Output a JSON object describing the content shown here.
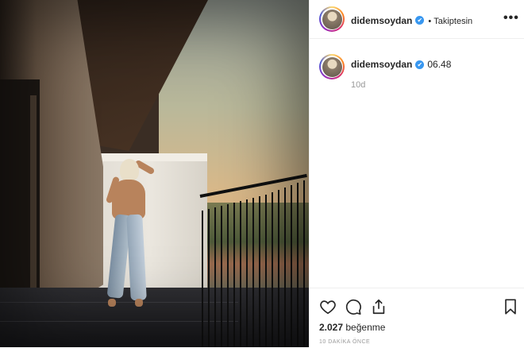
{
  "post": {
    "username": "didemsoydan",
    "verified_glyph": "✔",
    "separator": "•",
    "follow_status": "Takiptesin",
    "more_label": "•••",
    "comment": {
      "username": "didemsoydan",
      "text": "06.48",
      "age": "10d"
    },
    "likes_count": "2.027",
    "likes_word": "beğenme",
    "time_ago": "10 DAKİKA ÖNCE"
  },
  "icons": {
    "like": "heart-icon",
    "comment": "comment-icon",
    "share": "share-icon",
    "save": "bookmark-icon",
    "verified": "verified-badge-icon",
    "more": "more-options-icon"
  },
  "colors": {
    "verified": "#3897f0",
    "text": "#262626",
    "muted": "#999999",
    "divider": "#efefef"
  }
}
